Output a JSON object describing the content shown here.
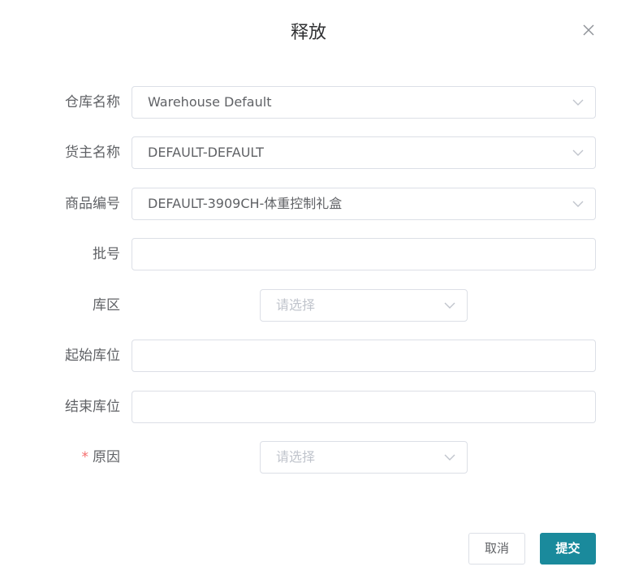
{
  "dialog": {
    "title": "释放",
    "close_icon": "close-icon"
  },
  "form": {
    "warehouse": {
      "label": "仓库名称",
      "value": "Warehouse Default"
    },
    "owner": {
      "label": "货主名称",
      "value": "DEFAULT-DEFAULT"
    },
    "item": {
      "label": "商品编号",
      "value": "DEFAULT-3909CH-体重控制礼盒"
    },
    "lot": {
      "label": "批号",
      "value": ""
    },
    "zone": {
      "label": "库区",
      "placeholder": "请选择"
    },
    "from_location": {
      "label": "起始库位",
      "value": ""
    },
    "to_location": {
      "label": "结束库位",
      "value": ""
    },
    "reason": {
      "label": "原因",
      "required_mark": "*",
      "placeholder": "请选择"
    }
  },
  "footer": {
    "cancel_label": "取消",
    "submit_label": "提交"
  },
  "colors": {
    "primary": "#1a8a9c",
    "required": "#f56c6c",
    "border": "#dcdfe6",
    "placeholder": "#c0c4cc"
  }
}
